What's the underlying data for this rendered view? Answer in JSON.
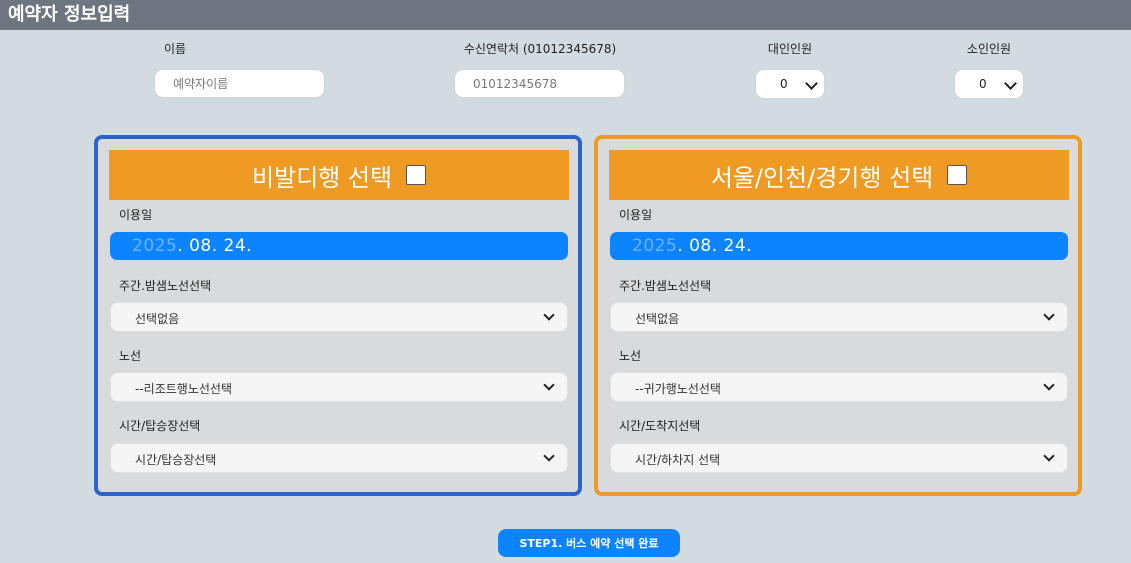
{
  "header": {
    "title": "예약자 정보입력"
  },
  "form": {
    "name_label": "이름",
    "name_placeholder": "예약자이름",
    "phone_label": "수신연락처 (01012345678)",
    "phone_placeholder": "01012345678",
    "adult_label": "대인인원",
    "adult_value": "0",
    "child_label": "소인인원",
    "child_value": "0"
  },
  "panels": [
    {
      "title": "비발디행 선택",
      "date_label": "이용일",
      "date_year": "2025",
      "date_rest": ". 08. 24.",
      "route_type_label": "주간.밤샘노선선택",
      "route_type_value": "선택없음",
      "route_label": "노선",
      "route_value": "--리조트행노선선택",
      "time_label": "시간/탑승장선택",
      "time_value": "시간/탑승장선택"
    },
    {
      "title": "서울/인천/경기행 선택",
      "date_label": "이용일",
      "date_year": "2025",
      "date_rest": ". 08. 24.",
      "route_type_label": "주간.밤샘노선선택",
      "route_type_value": "선택없음",
      "route_label": "노선",
      "route_value": "--귀가행노선선택",
      "time_label": "시간/도착지선택",
      "time_value": "시간/하차지 선택"
    }
  ],
  "submit": {
    "label": "STEP1. 버스 예약 선택 완료"
  },
  "colors": {
    "accent_blue": "#0d84ff",
    "panel_blue_border": "#2f63cc",
    "accent_orange": "#ef9a22"
  }
}
